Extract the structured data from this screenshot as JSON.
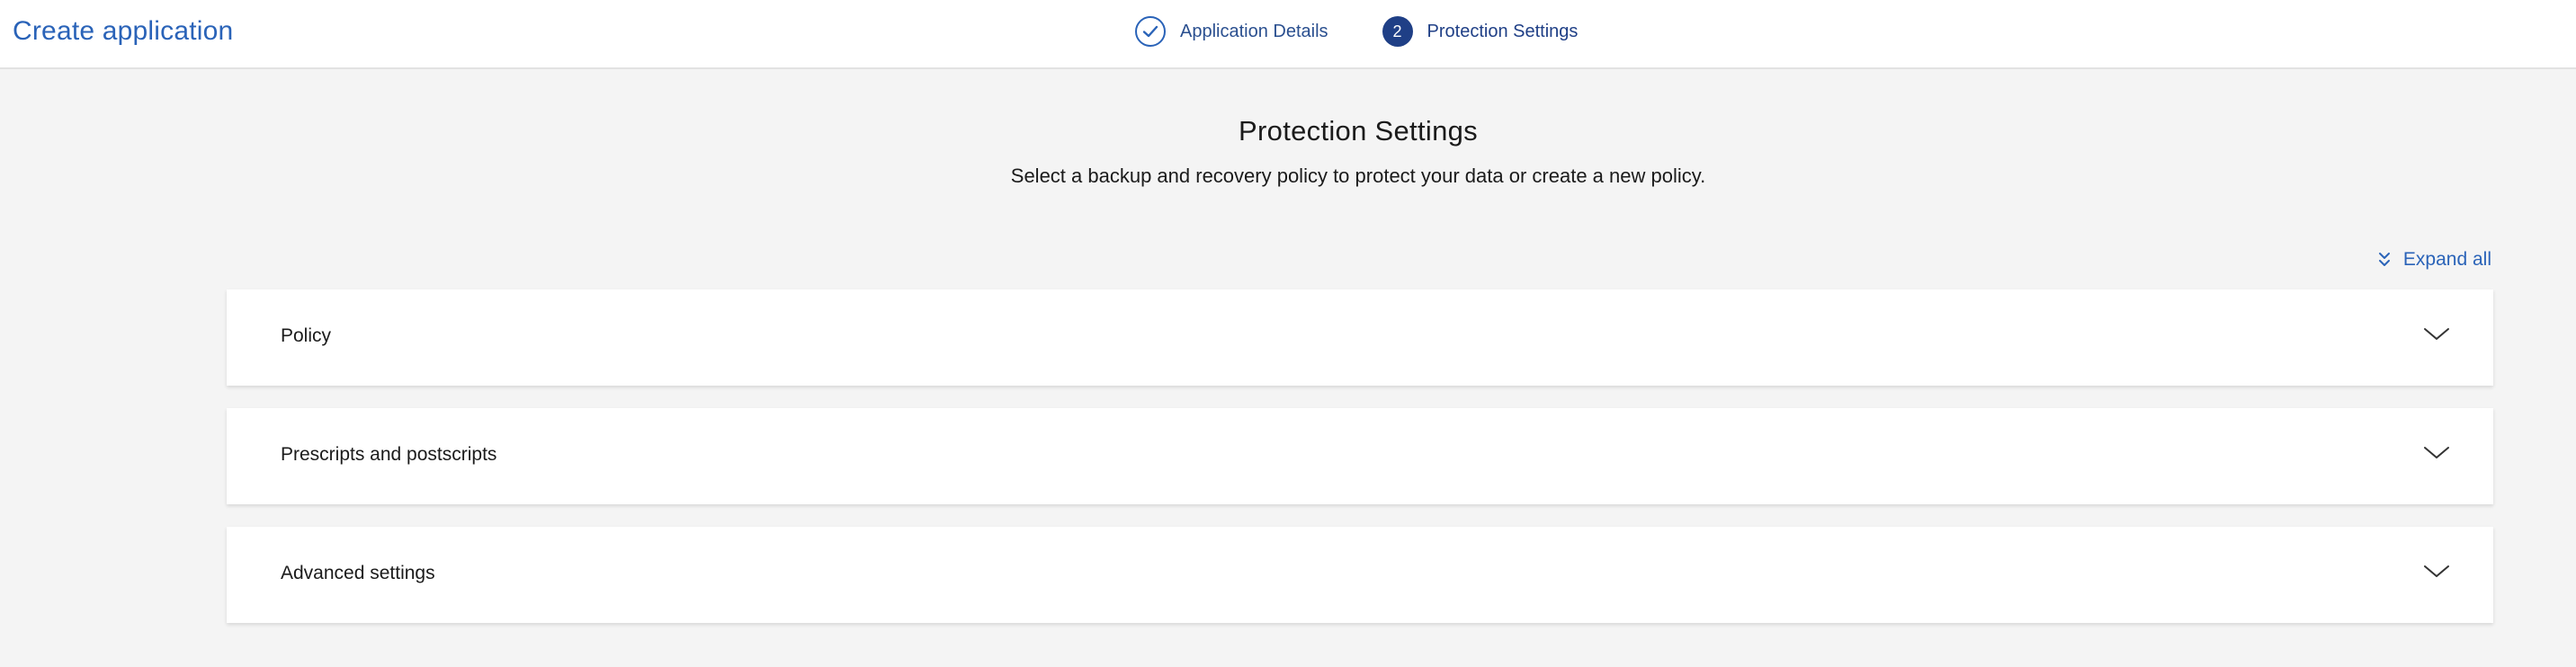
{
  "header": {
    "app_title": "Create application",
    "steps": [
      {
        "label": "Application Details",
        "state": "completed",
        "icon": "check-icon"
      },
      {
        "label": "Protection Settings",
        "state": "active",
        "number": "2"
      }
    ]
  },
  "main": {
    "title": "Protection Settings",
    "subtitle": "Select a backup and recovery policy to protect your data or create a new policy.",
    "expand_all": "Expand all",
    "sections": [
      {
        "label": "Policy",
        "expanded": false
      },
      {
        "label": "Prescripts and postscripts",
        "expanded": false
      },
      {
        "label": "Advanced settings",
        "expanded": false
      }
    ]
  },
  "colors": {
    "accent": "#2a63b8",
    "active_step": "#1f3f86",
    "page_bg": "#f4f4f4",
    "panel_bg": "#ffffff"
  }
}
